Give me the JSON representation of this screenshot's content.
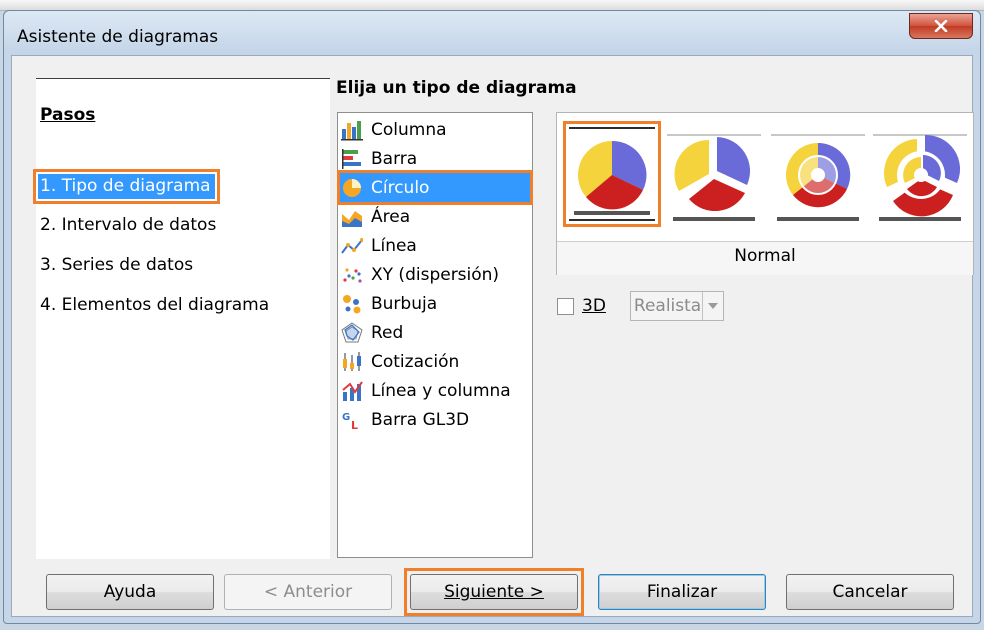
{
  "window": {
    "title": "Asistente de diagramas"
  },
  "steps": {
    "heading": "Pasos",
    "items": [
      {
        "label": "1. Tipo de diagrama",
        "active": true
      },
      {
        "label": "2. Intervalo de datos",
        "active": false
      },
      {
        "label": "3. Series de datos",
        "active": false
      },
      {
        "label": "4. Elementos del diagrama",
        "active": false
      }
    ]
  },
  "main": {
    "section_title": "Elija un tipo de diagrama",
    "chart_types": [
      {
        "label": "Columna",
        "icon": "column-chart-icon"
      },
      {
        "label": "Barra",
        "icon": "bar-chart-icon"
      },
      {
        "label": "Círculo",
        "icon": "pie-chart-icon",
        "selected": true
      },
      {
        "label": "Área",
        "icon": "area-chart-icon"
      },
      {
        "label": "Línea",
        "icon": "line-chart-icon"
      },
      {
        "label": "XY (dispersión)",
        "icon": "scatter-chart-icon"
      },
      {
        "label": "Burbuja",
        "icon": "bubble-chart-icon"
      },
      {
        "label": "Red",
        "icon": "net-chart-icon"
      },
      {
        "label": "Cotización",
        "icon": "stock-chart-icon"
      },
      {
        "label": "Línea y columna",
        "icon": "column-line-chart-icon"
      },
      {
        "label": "Barra GL3D",
        "icon": "gl3d-bar-chart-icon"
      }
    ],
    "variant_caption": "Normal",
    "threed_label": "3D",
    "threed_checked": false,
    "shape_select_value": "Realista"
  },
  "buttons": {
    "help": "Ayuda",
    "previous": "< Anterior",
    "next": "Siguiente >",
    "finish": "Finalizar",
    "cancel": "Cancelar"
  },
  "colors": {
    "pie_yellow": "#f5d33c",
    "pie_blue": "#6a6ad8",
    "pie_red": "#cc1f1f",
    "highlight": "#f07f2c",
    "selection": "#3399ff"
  }
}
